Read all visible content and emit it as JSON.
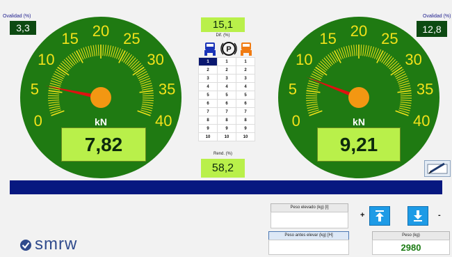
{
  "left_gauge": {
    "ovalidad_label": "Ovalidad (%)",
    "ovalidad_value": "3,3",
    "unit": "kN",
    "reading": "7,82",
    "needle_value": 5.8,
    "ticks": [
      "0",
      "5",
      "10",
      "15",
      "20",
      "25",
      "30",
      "35",
      "40"
    ]
  },
  "right_gauge": {
    "ovalidad_label": "Ovalidad (%)",
    "ovalidad_value": "12,8",
    "unit": "kN",
    "reading": "9,21",
    "needle_value": 7.5,
    "ticks": [
      "0",
      "5",
      "10",
      "15",
      "20",
      "25",
      "30",
      "35",
      "40"
    ]
  },
  "center": {
    "dif_value": "15,1",
    "dif_label": "Dif. (%)",
    "rend_value": "58,2",
    "rend_label": "Rend. (%)",
    "parking_symbol": "P",
    "gear_rows": [
      [
        "1",
        "1",
        "1"
      ],
      [
        "2",
        "2",
        "2"
      ],
      [
        "3",
        "3",
        "3"
      ],
      [
        "4",
        "4",
        "4"
      ],
      [
        "5",
        "5",
        "5"
      ],
      [
        "6",
        "6",
        "6"
      ],
      [
        "7",
        "7",
        "7"
      ],
      [
        "8",
        "8",
        "8"
      ],
      [
        "9",
        "9",
        "9"
      ],
      [
        "10",
        "10",
        "10"
      ]
    ],
    "selected_cell": "1"
  },
  "bottom": {
    "peso_elevado_label": "Peso elevado (kg) [I]",
    "peso_elevado_value": "",
    "peso_antes_label": "Peso antes elevar (kg) [H]",
    "peso_antes_value": "",
    "peso_label": "Peso (kg)",
    "peso_value": "2980",
    "plus": "+",
    "minus": "-"
  },
  "brand": {
    "logo_text": "smrw"
  },
  "colors": {
    "dial_green": "#1f7a12",
    "dial_dark": "#0d4a12",
    "dial_yellow": "#f2e21a",
    "hub_orange": "#f39712",
    "readout_green": "#b9f04a",
    "bar_blue": "#071880",
    "button_blue": "#1e9be6",
    "truck_blue": "#1a34b8",
    "truck_orange": "#f07b12"
  },
  "icons": {
    "truck_left": "truck-blue-icon",
    "parking": "parking-icon",
    "truck_right": "truck-orange-icon",
    "up": "arrow-up-icon",
    "down": "arrow-down-icon",
    "edit": "pen-edit-icon",
    "logo": "check-chevron-icon"
  }
}
